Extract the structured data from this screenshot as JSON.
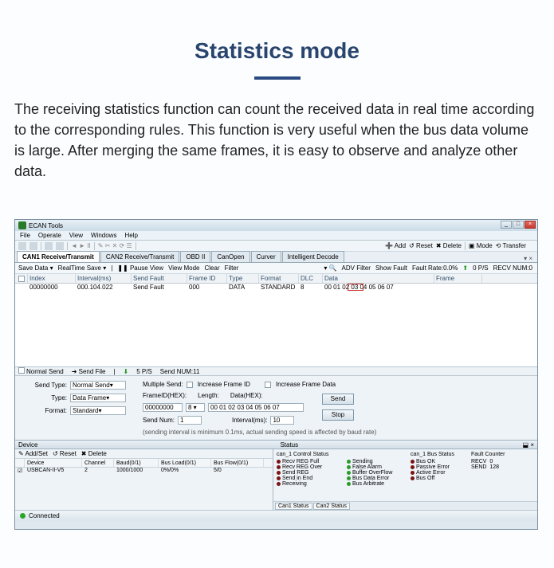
{
  "page": {
    "title": "Statistics mode",
    "description": "The receiving statistics function can count the received data in real time according to the corresponding rules. This function is very useful when the bus data volume is large. After merging the same frames, it is easy to observe and analyze other data."
  },
  "app": {
    "title": "ECAN Tools",
    "menu": [
      "File",
      "Operate",
      "View",
      "Windows",
      "Help"
    ],
    "toolbar_right": {
      "add": "Add",
      "reset": "Reset",
      "delete": "Delete",
      "mode": "Mode",
      "transfer": "Transfer"
    },
    "tabs": [
      "CAN1 Receive/Transmit",
      "CAN2 Receive/Transmit",
      "OBD II",
      "CanOpen",
      "Curver",
      "Intelligent Decode"
    ],
    "toolbar2": {
      "save": "Save Data ▾",
      "realtime": "RealTime Save ▾",
      "pause": "Pause View",
      "viewmode": "View Mode",
      "clear": "Clear",
      "filter": "Filter",
      "adv": "ADV Filter",
      "showfault": "Show Fault",
      "faultrate": "Fault Rate:0.0%",
      "pps": "0 P/S",
      "recvnum": "RECV NUM:0"
    },
    "grid_headers": [
      "",
      "Index",
      "Interval(ms)",
      "Send Fault",
      "Frame ID",
      "Type",
      "Format",
      "DLC",
      "Data",
      "Frame"
    ],
    "grid_row": [
      "",
      "00000000",
      "000.104.022",
      "Send Fault",
      "000",
      "DATA",
      "STANDARD",
      "8",
      "00 01 02 03 04 05 06 07",
      ""
    ],
    "midbar": {
      "normal": "Normal Send",
      "sendfile": "Send File",
      "pps": "5 P/S",
      "sendnum": "Send NUM:11"
    },
    "send": {
      "sendtype_lbl": "Send Type:",
      "sendtype": "Normal Send",
      "type_lbl": "Type:",
      "type": "Data Frame",
      "format_lbl": "Format:",
      "format": "Standard",
      "multiple": "Multiple Send:",
      "inc_id": "Increase Frame ID",
      "inc_data": "Increase Frame Data",
      "frameid_lbl": "FrameID(HEX):",
      "frameid": "00000000",
      "length_lbl": "Length:",
      "length": "8 ▾",
      "data_lbl": "Data(HEX):",
      "data": "00 01 02 03 04 05 06 07",
      "sendnum_lbl": "Send Num:",
      "sendnum": "1",
      "interval_lbl": "Interval(ms):",
      "interval": "10",
      "note": "(sending interval is minimum 0.1ms, actual sending speed is affected by baud rate)",
      "send_btn": "Send",
      "stop_btn": "Stop"
    },
    "device_header": "Device",
    "device_tb": {
      "addset": "Add/Set",
      "reset": "Reset",
      "delete": "Delete"
    },
    "device_cols": [
      "",
      "Device",
      "Channel",
      "Baud(0/1)",
      "Bus Load(0/1)",
      "Bus Flow(0/1)"
    ],
    "device_row": [
      "☑",
      "USBCAN-II-V5",
      "2",
      "1000/1000",
      "0%/0%",
      "5/0"
    ],
    "status_header": "Status",
    "status": {
      "col1_h": "can_1 Control Status",
      "col1": [
        "Recv REG Full",
        "Recv REG Over",
        "Send REG",
        "Send in End",
        "Receiving"
      ],
      "col2": [
        "Sending",
        "False Alarm",
        "Buffer OverFlow",
        "Bus Data Error",
        "Bus Arbitrate"
      ],
      "col3_h": "can_1 Bus Status",
      "col3": [
        "Bus OK",
        "Passive Error",
        "Active Error",
        "Bus Off"
      ],
      "col4_h": "Fault Counter",
      "recv": "RECV",
      "recv_v": "0",
      "send": "SEND",
      "send_v": "128",
      "tabs": [
        "Can1 Status",
        "Can2 Status"
      ]
    },
    "footer": "Connected"
  }
}
